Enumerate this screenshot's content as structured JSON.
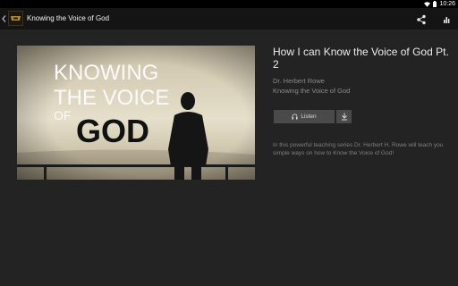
{
  "status_bar": {
    "time": "10:26"
  },
  "app_bar": {
    "title": "Knowing the Voice of God",
    "share_icon": "share-icon",
    "stats_icon": "stats-icon"
  },
  "artwork": {
    "lines": [
      "KNOWING",
      "THE VOICE",
      "OF",
      "GOD"
    ]
  },
  "sermon": {
    "title": "How I can Know the Voice of God Pt. 2",
    "speaker": "Dr. Herbert Rowe",
    "series": "Knowing the Voice of God",
    "listen_label": "Listen",
    "description": "In this powerful teaching series Dr. Herbert H. Rowe will teach you simple ways on how to Know the Voice of God!"
  },
  "colors": {
    "background": "#232323",
    "app_bar": "#141414",
    "button": "#4a4a4a"
  }
}
